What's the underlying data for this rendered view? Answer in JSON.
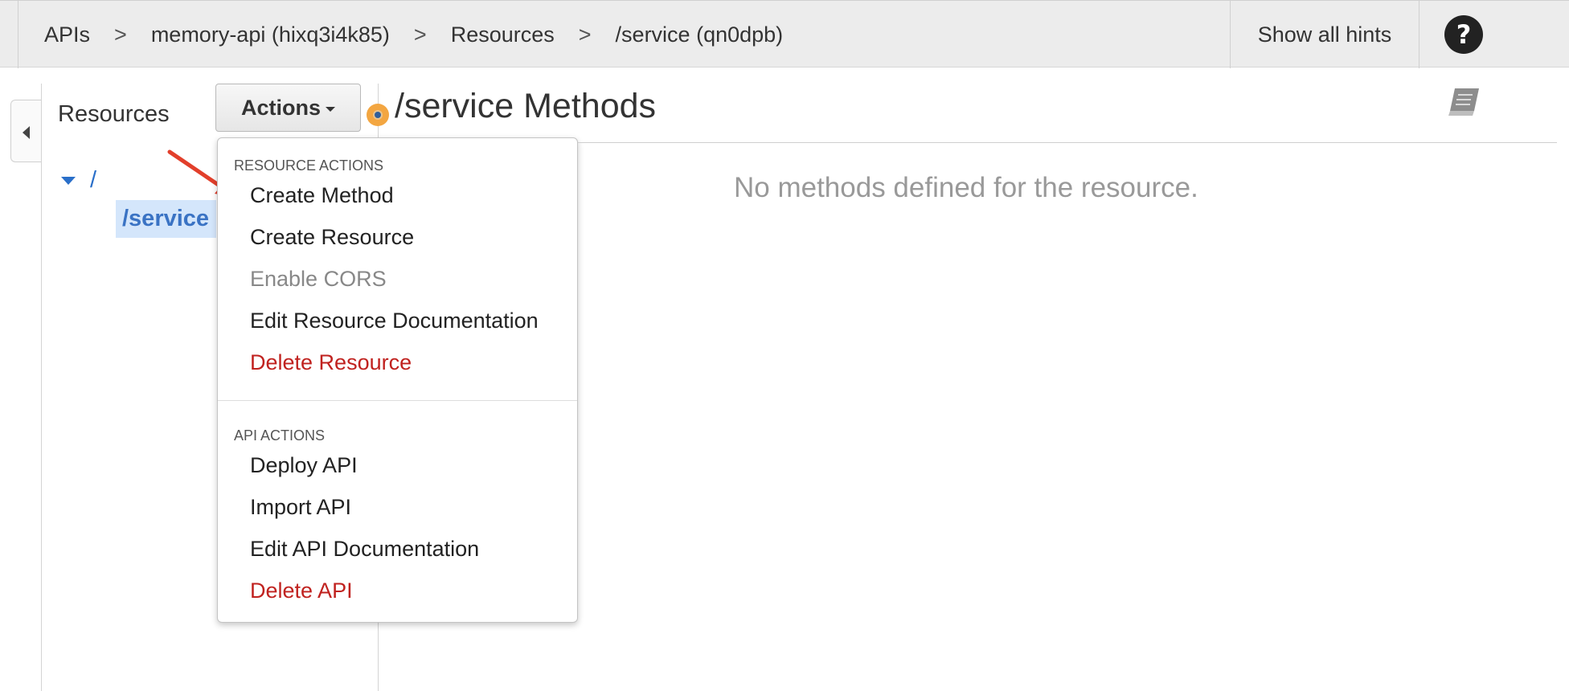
{
  "breadcrumb": {
    "items": [
      "APIs",
      "memory-api (hixq3i4k85)",
      "Resources",
      "/service (qn0dpb)"
    ],
    "separator": ">"
  },
  "header": {
    "hints_label": "Show all hints",
    "help_glyph": "?"
  },
  "sidebar": {
    "title": "Resources",
    "actions_label": "Actions",
    "tree": {
      "root": "/",
      "child": "/service"
    }
  },
  "menu": {
    "resource_header": "RESOURCE ACTIONS",
    "resource_items": [
      "Create Method",
      "Create Resource",
      "Enable CORS",
      "Edit Resource Documentation",
      "Delete Resource"
    ],
    "api_header": "API ACTIONS",
    "api_items": [
      "Deploy API",
      "Import API",
      "Edit API Documentation",
      "Delete API"
    ]
  },
  "main": {
    "title": "/service Methods",
    "empty_message": "No methods defined for the resource."
  },
  "colors": {
    "link_blue": "#2a6fc9",
    "danger_red": "#c0221f",
    "arrow_red": "#e23f2b",
    "status_orange": "#f3a641"
  },
  "icons": [
    "help-icon",
    "collapse-icon",
    "caret-down-icon",
    "tree-expanded-icon",
    "arrow-annotation-icon",
    "status-dot-icon",
    "documentation-icon"
  ]
}
